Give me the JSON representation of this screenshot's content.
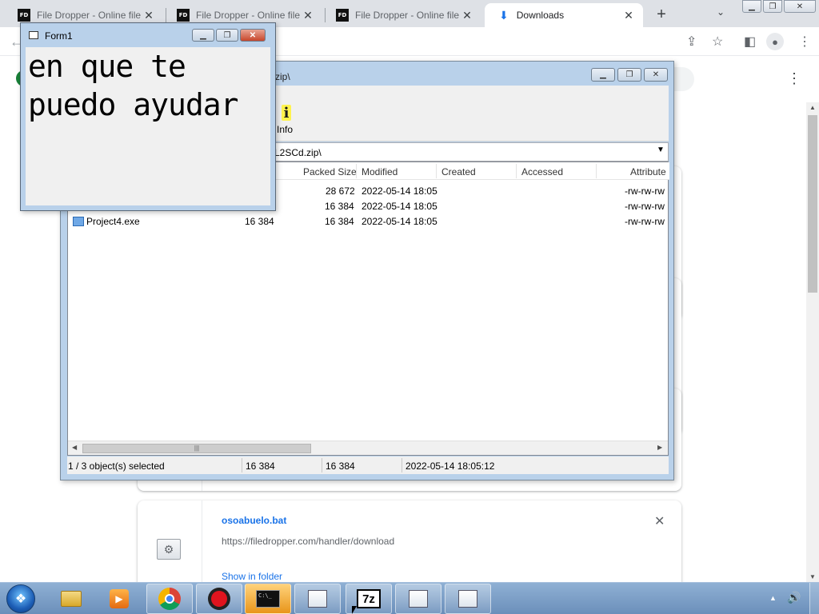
{
  "chrome": {
    "tabs": [
      {
        "favicon": "FD",
        "title": "File Dropper - Online file"
      },
      {
        "favicon": "FD",
        "title": "File Dropper - Online file"
      },
      {
        "favicon": "FD",
        "title": "File Dropper - Online file"
      },
      {
        "favicon": "download-icon",
        "title": "Downloads"
      }
    ],
    "tab_close": "✕",
    "new_tab": "+",
    "accent_color": "#1a73e8"
  },
  "downloads": {
    "item": {
      "filename": "osoabuelo.bat",
      "url": "https://filedropper.com/handler/download",
      "action": "Show in folder",
      "remove": "✕"
    }
  },
  "sevenzip": {
    "title_fragment": "zip\\",
    "toolbar_info_label": "Info",
    "path_fragment": "L2SCd.zip\\",
    "columns": [
      "Packed Size",
      "Modified",
      "Created",
      "Accessed",
      "Attribute"
    ],
    "rows": [
      {
        "name": "",
        "size": "",
        "packed": "28 672",
        "modified": "2022-05-14 18:05",
        "attributes": "-rw-rw-rw"
      },
      {
        "name": "",
        "size": "",
        "packed": "16 384",
        "modified": "2022-05-14 18:05",
        "attributes": "-rw-rw-rw"
      },
      {
        "name": "Project4.exe",
        "size": "16 384",
        "packed": "16 384",
        "modified": "2022-05-14 18:05",
        "attributes": "-rw-rw-rw"
      }
    ],
    "status": {
      "selection": "1 / 3 object(s) selected",
      "size": "16 384",
      "packed": "16 384",
      "modified": "2022-05-14 18:05:12"
    }
  },
  "form1": {
    "title": "Form1",
    "label_text": "en que te puedo ayudar"
  },
  "taskbar": {
    "apps": [
      "explorer-icon",
      "media-player-icon",
      "chrome-icon",
      "recorder-icon",
      "cmd-icon",
      "window-icon",
      "7zip-icon",
      "window-icon",
      "window-icon"
    ],
    "cmd_glyph": "C:\\_",
    "sevenzip_glyph": "7z"
  }
}
